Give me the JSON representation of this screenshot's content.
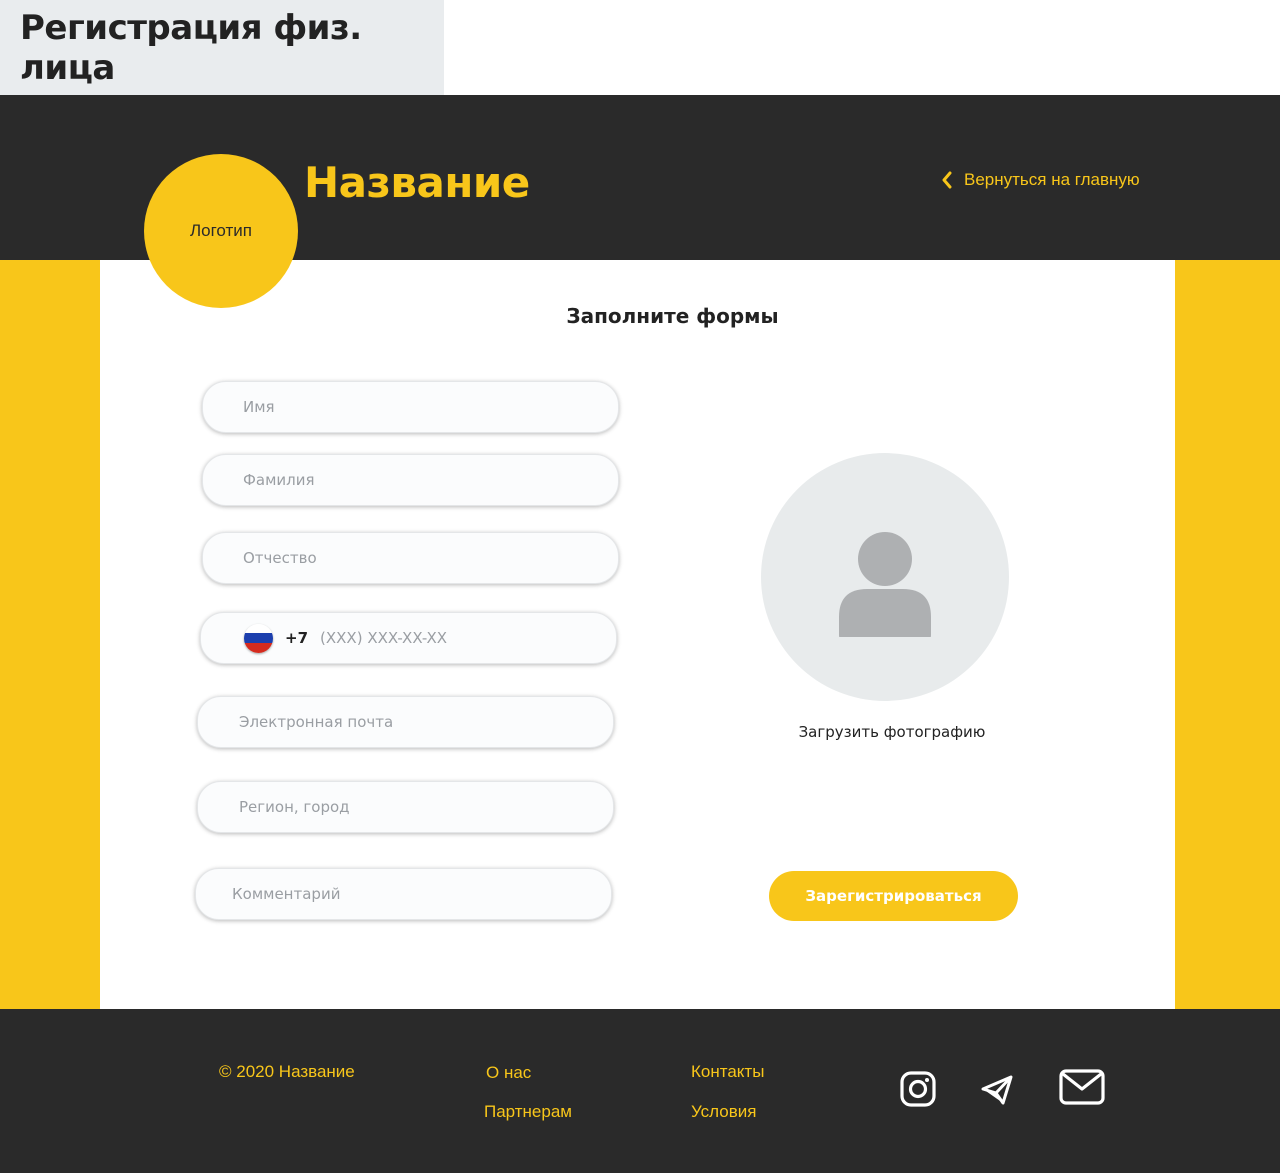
{
  "caption": "Регистрация физ. лица",
  "header": {
    "logo_label": "Логотип",
    "brand": "Название",
    "back_link": "Вернуться на главную"
  },
  "form": {
    "title": "Заполните формы",
    "first_name_placeholder": "Имя",
    "last_name_placeholder": "Фамилия",
    "patronymic_placeholder": "Отчество",
    "phone_code": "+7",
    "phone_placeholder": "(XXX) XXX-XX-XX",
    "email_placeholder": "Электронная почта",
    "region_placeholder": "Регион, город",
    "comment_placeholder": "Комментарий",
    "upload_photo": "Загрузить фотографию",
    "register_button": "Зарегистрироваться"
  },
  "footer": {
    "copyright": "© 2020 Название",
    "links": [
      "О нас",
      "Партнерам",
      "Контакты",
      "Условия"
    ],
    "social_icons": [
      "instagram-icon",
      "telegram-icon",
      "mail-icon"
    ]
  },
  "colors": {
    "accent": "#f8c61a",
    "dark": "#2a2a2a",
    "avatar_bg": "#e8ebec",
    "avatar_fg": "#aeb0b2"
  }
}
